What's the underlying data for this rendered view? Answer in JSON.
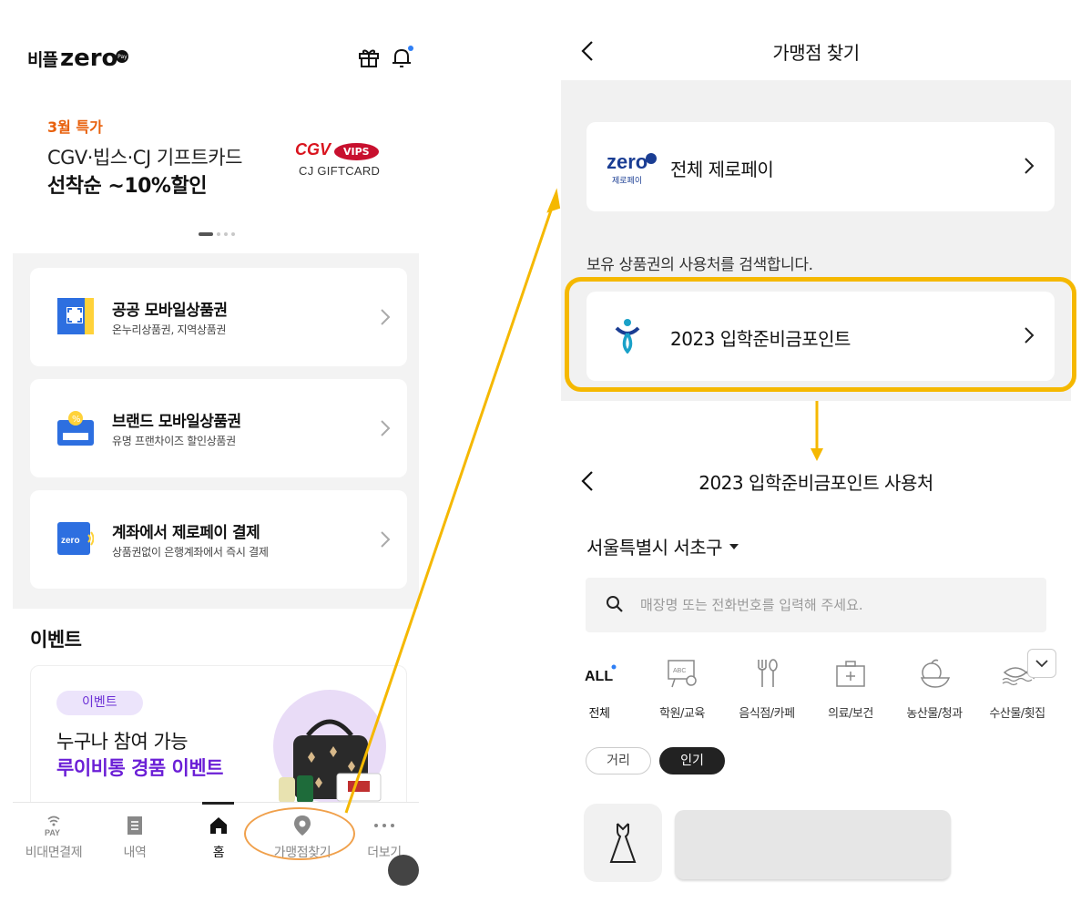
{
  "left": {
    "logo": {
      "korean": "비플",
      "brand": "zero",
      "badge": "Pay"
    },
    "banner": {
      "tag": "3월 특가",
      "line1": "CGV·빕스·CJ 기프트카드",
      "line2": "선착순 ~10%할인",
      "logo_cgv": "CGV",
      "logo_vips": "VIPS",
      "logo_cj": "CJ GIFTCARD"
    },
    "cards": [
      {
        "title": "공공 모바일상품권",
        "subtitle": "온누리상품권, 지역상품권"
      },
      {
        "title": "브랜드 모바일상품권",
        "subtitle": "유명 프랜차이즈 할인상품권"
      },
      {
        "title": "계좌에서 제로페이 결제",
        "subtitle": "상품권없이 은행계좌에서 즉시 결제"
      }
    ],
    "event": {
      "heading": "이벤트",
      "pill": "이벤트",
      "line1": "누구나 참여 가능",
      "line2": "루이비통 경품 이벤트"
    },
    "tabs": [
      {
        "label": "비대면결제",
        "icon_text": "PAY"
      },
      {
        "label": "내역"
      },
      {
        "label": "홈"
      },
      {
        "label": "가맹점찾기"
      },
      {
        "label": "더보기"
      }
    ],
    "active_tab": "홈"
  },
  "right_top": {
    "title": "가맹점 찾기",
    "zero_card": {
      "logo": "zero",
      "logo_sub": "제로페이",
      "label": "전체 제로페이"
    },
    "note": "보유 상품권의 사용처를 검색합니다.",
    "point_card": {
      "label": "2023 입학준비금포인트"
    }
  },
  "right_bottom": {
    "title": "2023 입학준비금포인트 사용처",
    "region": "서울특별시 서초구",
    "search_placeholder": "매장명 또는 전화번호를 입력해 주세요.",
    "categories": [
      {
        "label": "전체",
        "icon_text": "ALL"
      },
      {
        "label": "학원/교육"
      },
      {
        "label": "음식점/카페"
      },
      {
        "label": "의료/보건"
      },
      {
        "label": "농산물/청과"
      },
      {
        "label": "수산물/횟집"
      }
    ],
    "sort": [
      "거리",
      "인기"
    ],
    "active_sort": "인기"
  },
  "colors": {
    "accent_orange": "#e8600c",
    "highlight_yellow": "#f5b800",
    "event_purple": "#6b1fd6",
    "zero_blue": "#1a3d93",
    "notification_blue": "#2f7ff5"
  }
}
